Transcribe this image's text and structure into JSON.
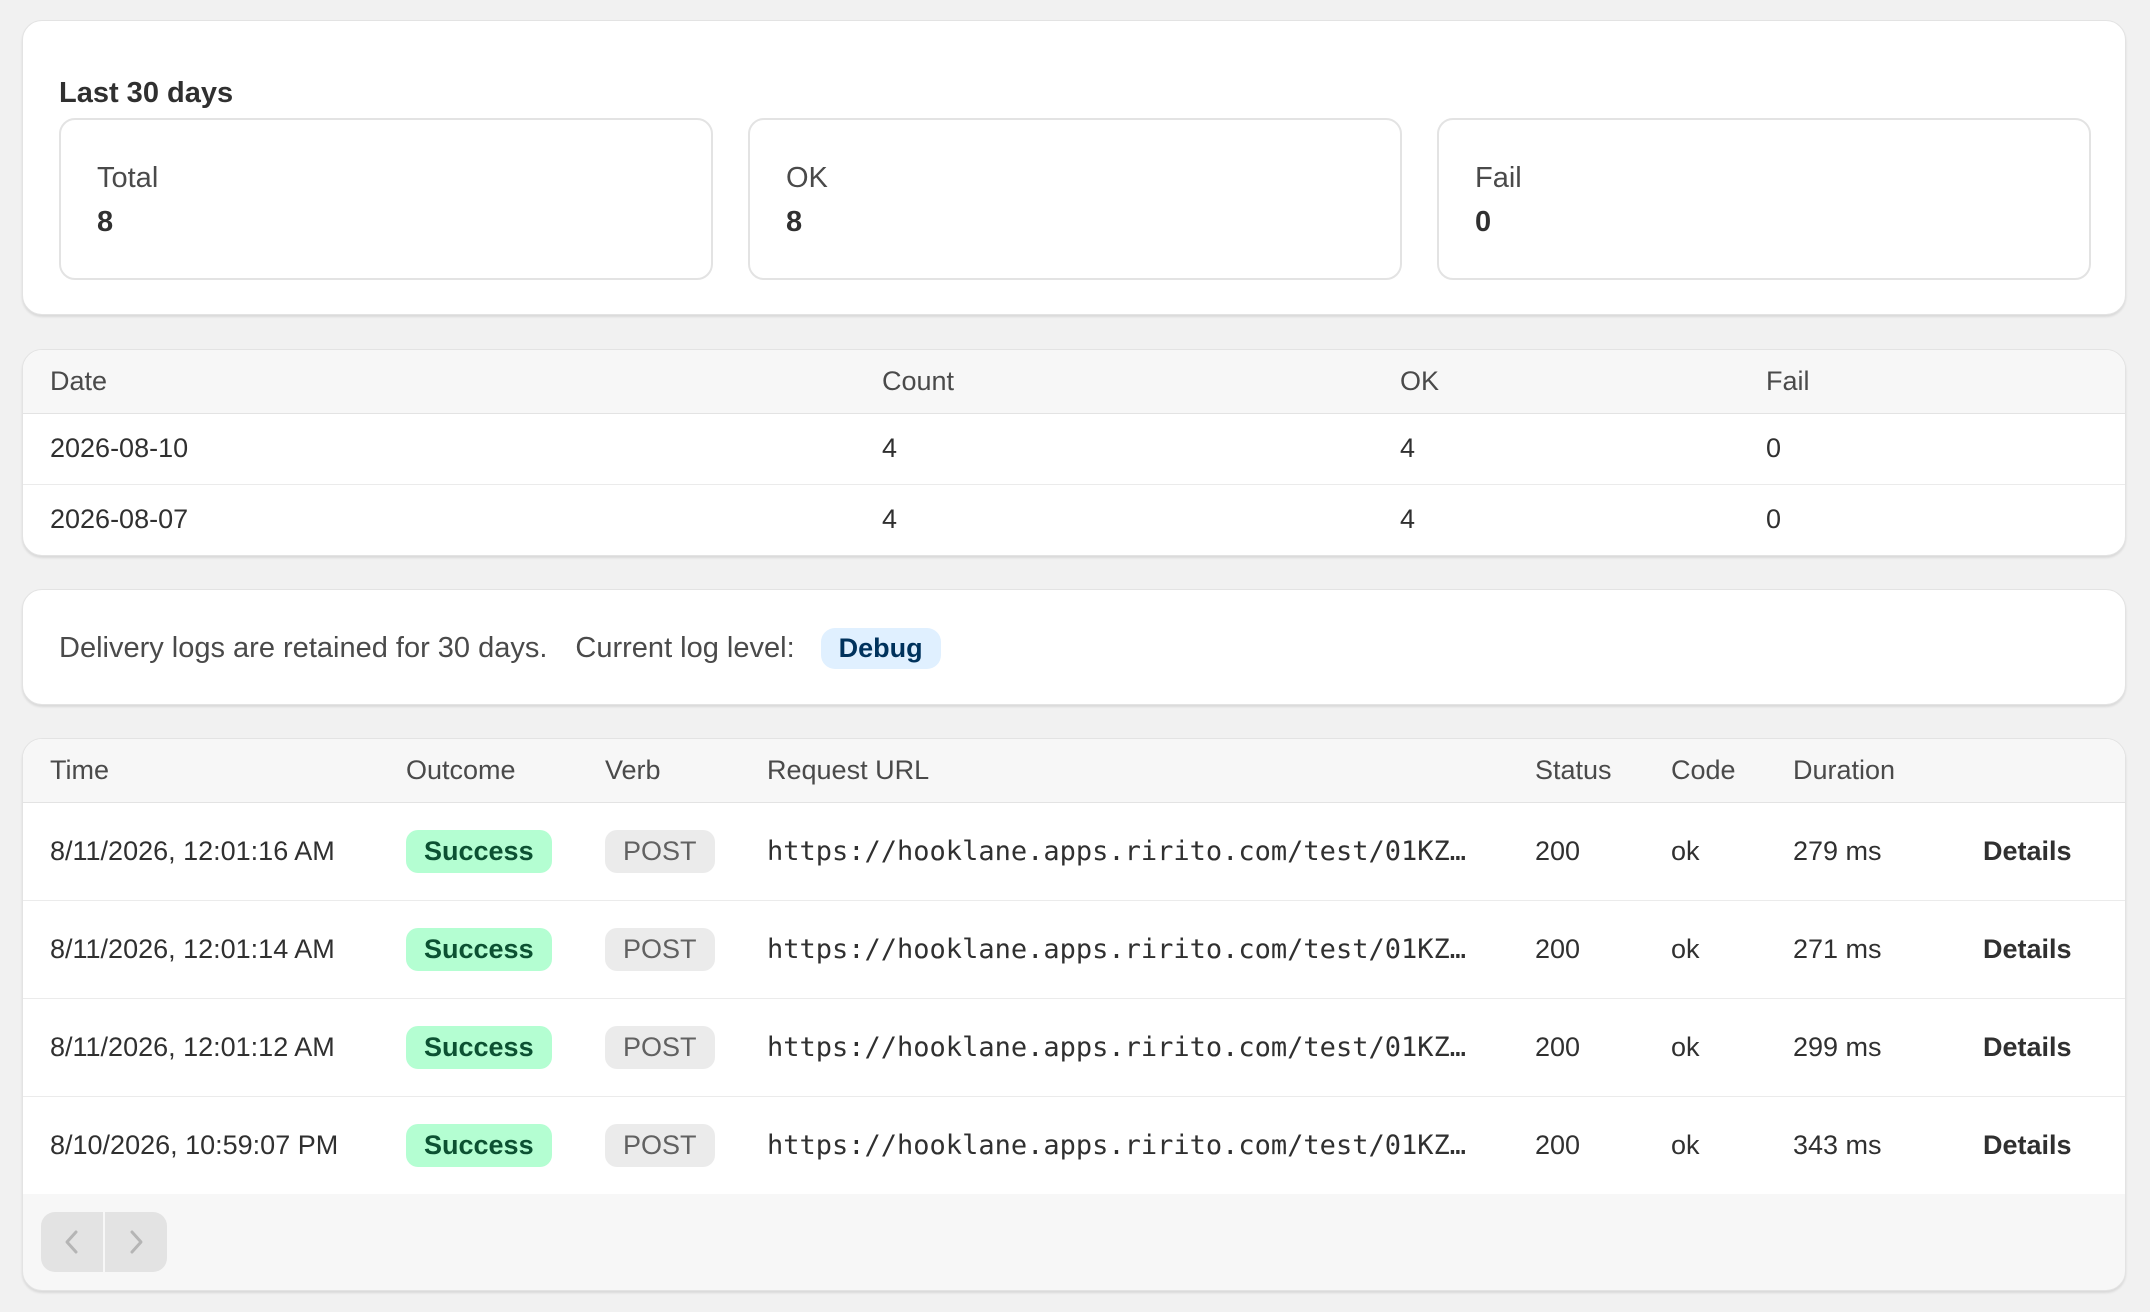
{
  "summary": {
    "title": "Last 30 days",
    "stats": [
      {
        "label": "Total",
        "value": "8"
      },
      {
        "label": "OK",
        "value": "8"
      },
      {
        "label": "Fail",
        "value": "0"
      }
    ]
  },
  "daily": {
    "headers": [
      "Date",
      "Count",
      "OK",
      "Fail"
    ],
    "rows": [
      [
        "2026-08-10",
        "4",
        "4",
        "0"
      ],
      [
        "2026-08-07",
        "4",
        "4",
        "0"
      ]
    ]
  },
  "info": {
    "retention_text": "Delivery logs are retained for 30 days.",
    "level_label": "Current log level:",
    "level_value": "Debug"
  },
  "logs": {
    "headers": [
      "Time",
      "Outcome",
      "Verb",
      "Request URL",
      "Status",
      "Code",
      "Duration",
      ""
    ],
    "details_label": "Details",
    "rows": [
      {
        "time": "8/11/2026, 12:01:16 AM",
        "outcome": "Success",
        "verb": "POST",
        "url": "https://hooklane.apps.ririto.com/test/01KZF…",
        "status": "200",
        "code": "ok",
        "duration": "279 ms"
      },
      {
        "time": "8/11/2026, 12:01:14 AM",
        "outcome": "Success",
        "verb": "POST",
        "url": "https://hooklane.apps.ririto.com/test/01KZF…",
        "status": "200",
        "code": "ok",
        "duration": "271 ms"
      },
      {
        "time": "8/11/2026, 12:01:12 AM",
        "outcome": "Success",
        "verb": "POST",
        "url": "https://hooklane.apps.ririto.com/test/01KZF…",
        "status": "200",
        "code": "ok",
        "duration": "299 ms"
      },
      {
        "time": "8/10/2026, 10:59:07 PM",
        "outcome": "Success",
        "verb": "POST",
        "url": "https://hooklane.apps.ririto.com/test/01KZF…",
        "status": "200",
        "code": "ok",
        "duration": "343 ms"
      }
    ]
  },
  "pager": {
    "prev_icon": "chevron-left-icon",
    "next_icon": "chevron-right-icon"
  },
  "colors": {
    "success_bg": "#b4fed2",
    "success_text": "#0c5132",
    "info_bg": "#e0f0ff",
    "info_text": "#00325c"
  }
}
